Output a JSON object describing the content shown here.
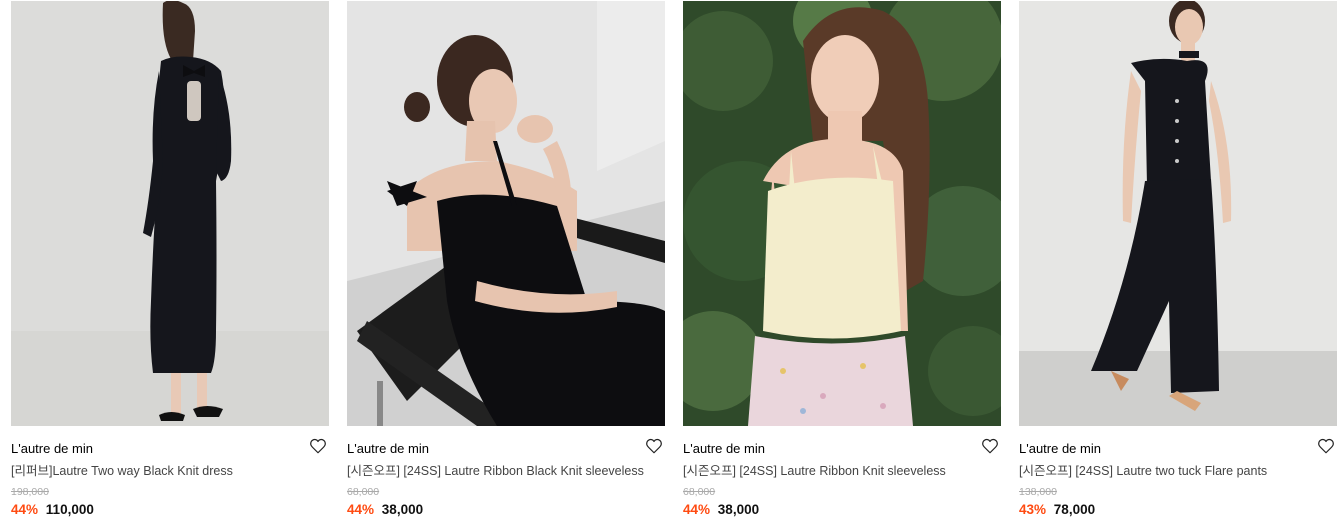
{
  "products": [
    {
      "brand": "L'autre de min",
      "name": "[리퍼브]Lautre Two way Black Knit dress",
      "original_price": "198,000",
      "discount": "44%",
      "price": "110,000",
      "image_desc": "model-black-knit-dress-back"
    },
    {
      "brand": "L'autre de min",
      "name": "[시즌오프] [24SS] Lautre Ribbon Black Knit sleeveless",
      "original_price": "68,000",
      "discount": "44%",
      "price": "38,000",
      "image_desc": "model-black-ribbon-sleeveless-chair"
    },
    {
      "brand": "L'autre de min",
      "name": "[시즌오프] [24SS] Lautre Ribbon Knit sleeveless",
      "original_price": "68,000",
      "discount": "44%",
      "price": "38,000",
      "image_desc": "model-cream-ribbon-sleeveless-greenery"
    },
    {
      "brand": "L'autre de min",
      "name": "[시즌오프] [24SS] Lautre two tuck Flare pants",
      "original_price": "138,000",
      "discount": "43%",
      "price": "78,000",
      "image_desc": "model-black-flare-pants"
    }
  ],
  "colors": {
    "discount": "#ff4b12",
    "original_price": "#aaaaaa",
    "name": "#444444"
  },
  "icons": {
    "wishlist": "heart-outline-icon"
  }
}
